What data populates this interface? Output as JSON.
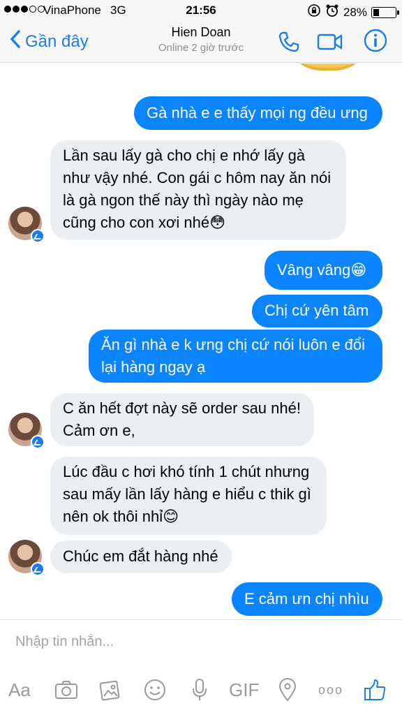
{
  "status": {
    "carrier": "VinaPhone",
    "network": "3G",
    "time": "21:56",
    "battery": "28%",
    "battery_level": 0.28
  },
  "header": {
    "back_label": "Gần đây",
    "contact_name": "Hien Doan",
    "contact_status": "Online 2 giờ trước"
  },
  "messages": [
    {
      "from": "me",
      "text": "Gà nhà e e thấy mọi ng đều ưng"
    },
    {
      "from": "contact",
      "text": "Lần sau lấy gà cho chị e nhớ lấy gà\nnhư vậy nhé. Con gái c hôm nay ăn nói\nlà gà ngon thế này thì ngày nào mẹ\ncũng cho con xơi nhé😳"
    },
    {
      "from": "me",
      "text": "Vâng vâng😁"
    },
    {
      "from": "me",
      "text": "Chị cứ yên tâm"
    },
    {
      "from": "me",
      "text": "Ăn gì nhà e k ưng chị cứ nói luôn e đổi\nlại hàng ngay ạ"
    },
    {
      "from": "contact",
      "text": "C ăn hết đợt này sẽ order sau nhé!\nCảm ơn e,"
    },
    {
      "from": "contact",
      "text": "Lúc đầu c hơi khó tính 1 chút nhưng\nsau mấy lần lấy hàng e hiểu c thik gì\nnên ok thôi nhỉ😊"
    },
    {
      "from": "contact",
      "text": "Chúc em đắt hàng nhé"
    },
    {
      "from": "me",
      "text": "E cảm ưn chị nhìu"
    }
  ],
  "composer": {
    "placeholder": "Nhập tin nhắn...",
    "text_tool": "Aa",
    "gif_tool": "GIF",
    "more_tool": "ooo"
  },
  "colors": {
    "accent": "#1b7cf0",
    "outgoing_bubble": "#0b84ff",
    "incoming_bubble": "#eceff1"
  }
}
